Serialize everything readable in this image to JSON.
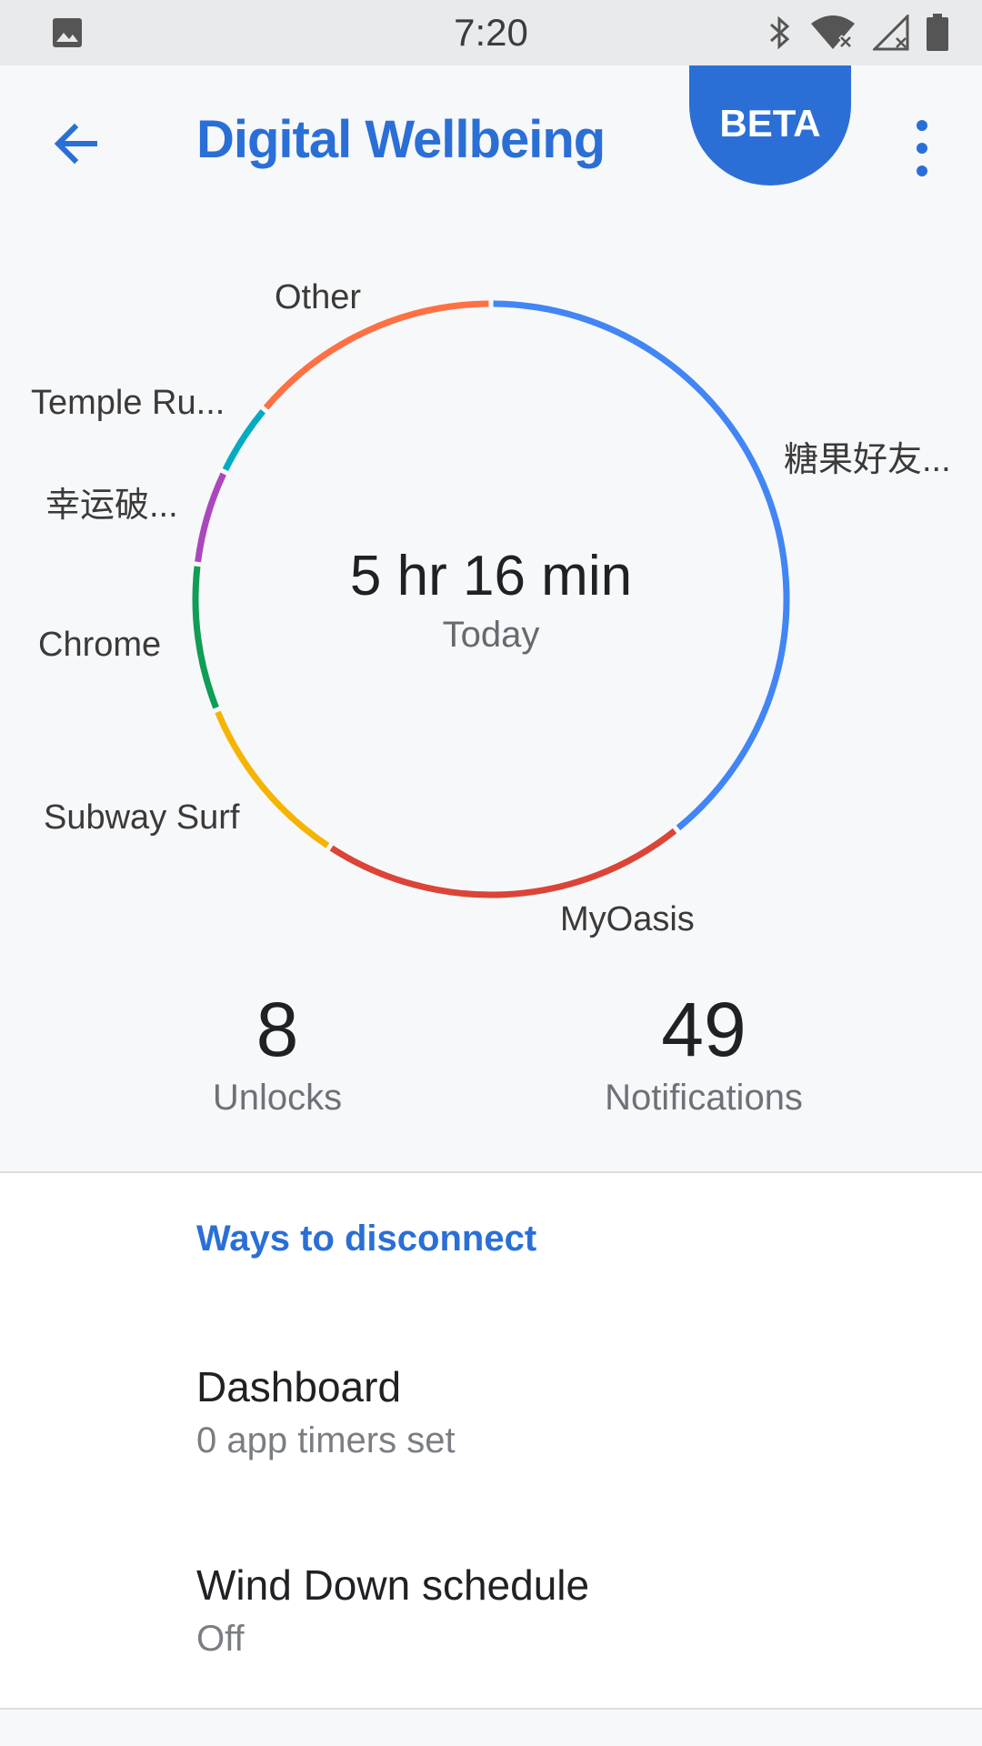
{
  "status_bar": {
    "time": "7:20",
    "icons": [
      "gallery-icon",
      "bluetooth-icon",
      "wifi-off-icon",
      "signal-off-icon",
      "battery-icon"
    ]
  },
  "app_bar": {
    "title": "Digital Wellbeing",
    "badge": "BETA",
    "back_icon": "arrow-back-icon",
    "more_icon": "more-vert-icon"
  },
  "usage": {
    "total": "5 hr 16 min",
    "period": "Today",
    "segments": [
      {
        "label": "糖果好友...",
        "color": "#4285f4",
        "fraction": 0.392
      },
      {
        "label": "MyOasis",
        "color": "#db4437",
        "fraction": 0.2
      },
      {
        "label": "Subway Surf",
        "color": "#f4b400",
        "fraction": 0.097
      },
      {
        "label": "Chrome",
        "color": "#0f9d58",
        "fraction": 0.08
      },
      {
        "label": "幸运破...",
        "color": "#ab47bc",
        "fraction": 0.052
      },
      {
        "label": "Temple Ru...",
        "color": "#00acc1",
        "fraction": 0.04
      },
      {
        "label": "Other",
        "color": "#ff7043",
        "fraction": 0.139
      }
    ]
  },
  "stats": {
    "unlocks": {
      "value": "8",
      "label": "Unlocks"
    },
    "notifications": {
      "value": "49",
      "label": "Notifications"
    }
  },
  "disconnect": {
    "header": "Ways to disconnect",
    "items": [
      {
        "title": "Dashboard",
        "subtitle": "0 app timers set"
      },
      {
        "title": "Wind Down schedule",
        "subtitle": "Off"
      }
    ]
  },
  "colors": {
    "accent": "#2a6fd6",
    "background": "#f7f8fa"
  }
}
